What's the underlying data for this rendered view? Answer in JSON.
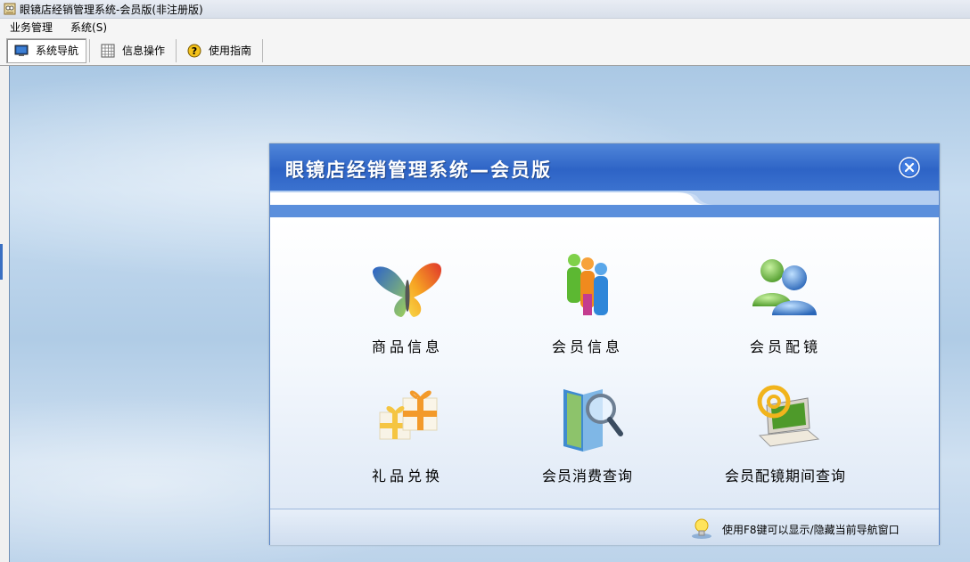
{
  "window": {
    "title": "眼镜店经销管理系统-会员版(非注册版)"
  },
  "menu": [
    "业务管理",
    "系统(S)"
  ],
  "toolbar": {
    "items": [
      {
        "label": "系统导航",
        "icon": "monitor-icon",
        "active": true
      },
      {
        "label": "信息操作",
        "icon": "grid-icon",
        "active": false
      },
      {
        "label": "使用指南",
        "icon": "help-icon",
        "active": false
      }
    ]
  },
  "nav": {
    "title": "眼镜店经销管理系统—会员版",
    "tiles": [
      {
        "label": "商品信息",
        "icon": "butterfly-icon"
      },
      {
        "label": "会员信息",
        "icon": "people-group-icon"
      },
      {
        "label": "会员配镜",
        "icon": "users-icon"
      },
      {
        "label": "礼品兑换",
        "icon": "gift-icon"
      },
      {
        "label": "会员消费查询",
        "icon": "book-search-icon"
      },
      {
        "label": "会员配镜期间查询",
        "icon": "laptop-email-icon"
      }
    ],
    "hint": "使用F8键可以显示/隐藏当前导航窗口"
  }
}
